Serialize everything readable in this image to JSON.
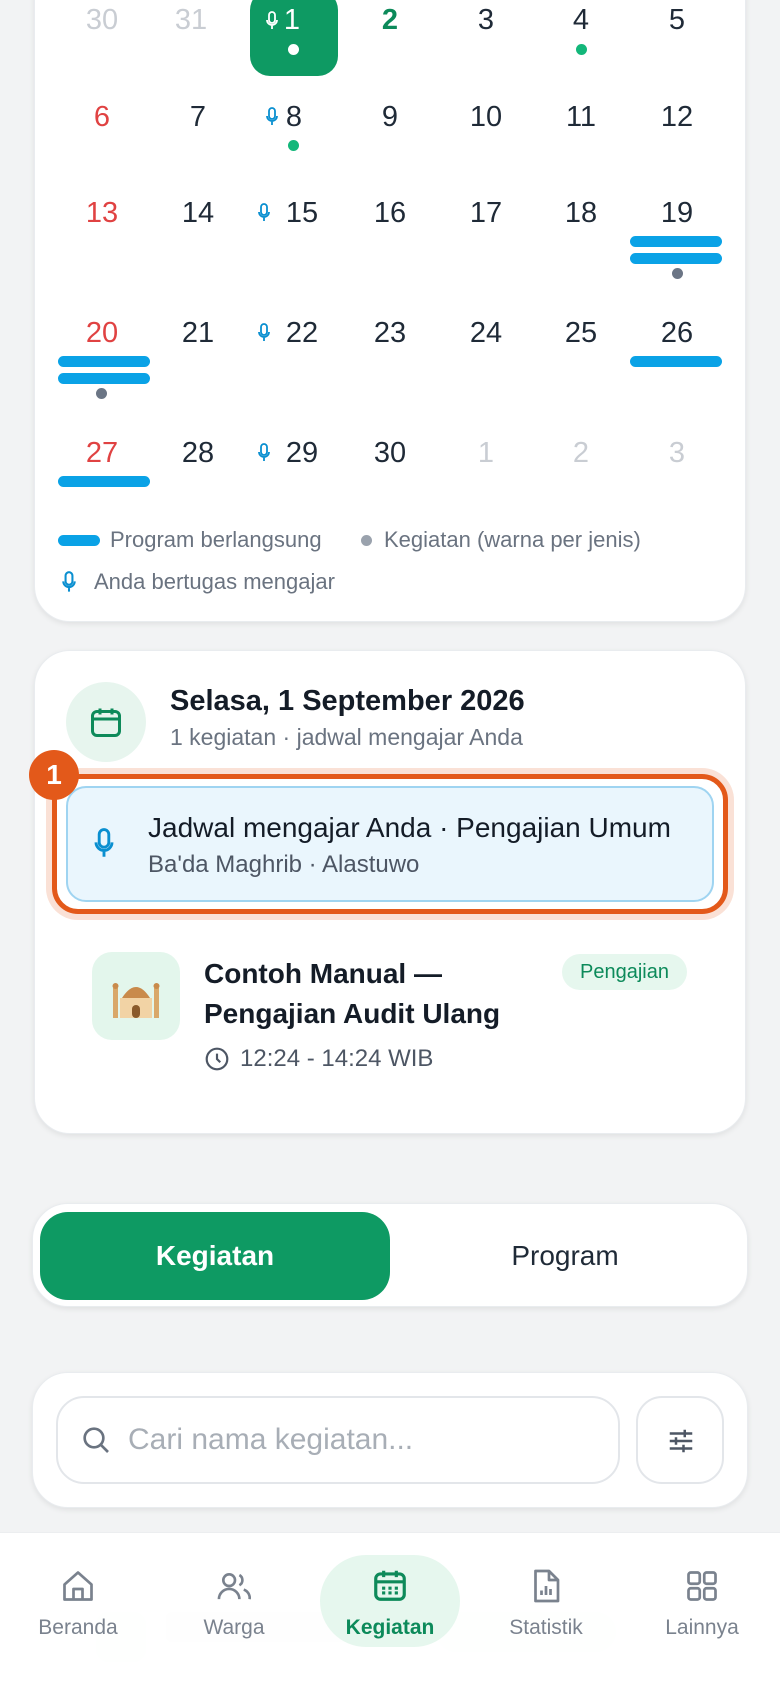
{
  "calendar": {
    "rows": [
      [
        "30",
        "31",
        "1",
        "2",
        "3",
        "4",
        "5"
      ],
      [
        "6",
        "7",
        "8",
        "9",
        "10",
        "11",
        "12"
      ],
      [
        "13",
        "14",
        "15",
        "16",
        "17",
        "18",
        "19"
      ],
      [
        "20",
        "21",
        "22",
        "23",
        "24",
        "25",
        "26"
      ],
      [
        "27",
        "28",
        "29",
        "30",
        "1",
        "2",
        "3"
      ]
    ],
    "legend": {
      "program": "Program berlangsung",
      "activity": "Kegiatan (warna per jenis)",
      "teaching": "Anda bertugas mengajar"
    }
  },
  "detail": {
    "date_title": "Selasa, 1 September 2026",
    "subtitle": "1 kegiatan · jadwal mengajar Anda",
    "badge_number": "1",
    "teaching": {
      "title": "Jadwal mengajar Anda · Pengajian Umum",
      "subtitle": "Ba'da Maghrib · Alastuwo"
    },
    "event": {
      "title": "Contoh Manual — Pengajian Audit Ulang",
      "category": "Pengajian",
      "time": "12:24 - 14:24 WIB"
    }
  },
  "segment": {
    "left": "Kegiatan",
    "right": "Program"
  },
  "search": {
    "placeholder": "Cari nama kegiatan..."
  },
  "nav": {
    "items": [
      {
        "label": "Beranda",
        "icon": "home-icon"
      },
      {
        "label": "Warga",
        "icon": "users-icon"
      },
      {
        "label": "Kegiatan",
        "icon": "calendar-icon"
      },
      {
        "label": "Statistik",
        "icon": "report-icon"
      },
      {
        "label": "Lainnya",
        "icon": "grid-icon"
      }
    ]
  },
  "colors": {
    "primary": "#0e9a63",
    "program_bar": "#0aa2e6",
    "highlight": "#e3591a",
    "sunday": "#e04242"
  }
}
